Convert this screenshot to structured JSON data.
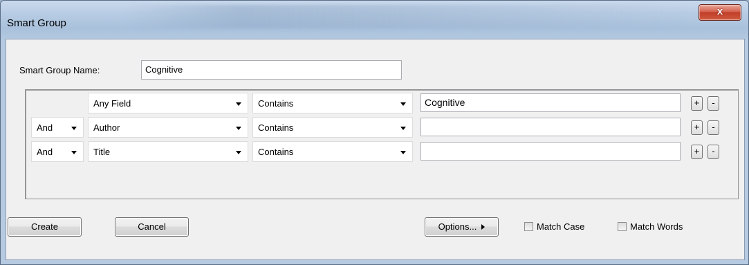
{
  "window": {
    "title": "Smart Group",
    "close_glyph": "x"
  },
  "form": {
    "name_label": "Smart Group Name:",
    "name_value": "Cognitive"
  },
  "rows": [
    {
      "connector": "",
      "field": "Any Field",
      "operator": "Contains",
      "value": "Cognitive",
      "add": "+",
      "remove": "-"
    },
    {
      "connector": "And",
      "field": "Author",
      "operator": "Contains",
      "value": "",
      "add": "+",
      "remove": "-"
    },
    {
      "connector": "And",
      "field": "Title",
      "operator": "Contains",
      "value": "",
      "add": "+",
      "remove": "-"
    }
  ],
  "footer": {
    "create": "Create",
    "cancel": "Cancel",
    "options": "Options...",
    "match_case": "Match Case",
    "match_words": "Match Words"
  },
  "icons": {
    "close": "close-icon",
    "dropdown": "chevron-down-icon",
    "options_arrow": "triangle-right-icon"
  },
  "colors": {
    "close_button": "#c8452d",
    "window_frame": "#b8cde4",
    "client_bg": "#f0f0f0"
  }
}
